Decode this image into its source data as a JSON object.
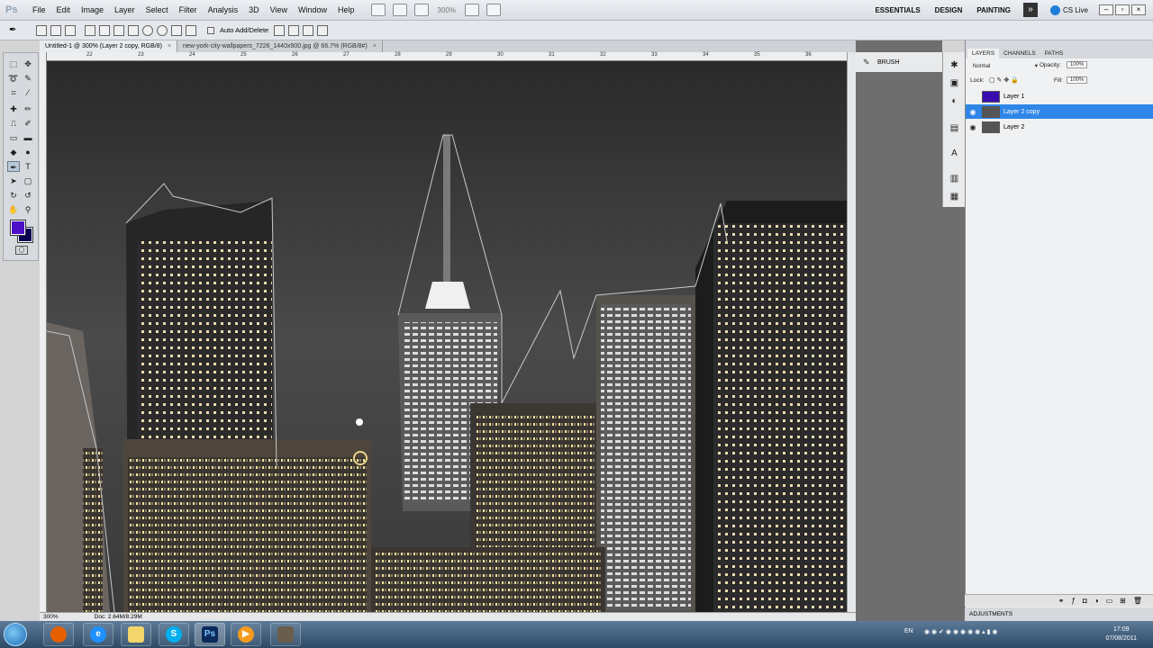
{
  "menu": {
    "logo": "Ps",
    "items": [
      "File",
      "Edit",
      "Image",
      "Layer",
      "Select",
      "Filter",
      "Analysis",
      "3D",
      "View",
      "Window",
      "Help"
    ],
    "zoom": "300%",
    "workspaces": [
      "ESSENTIALS",
      "DESIGN",
      "PAINTING"
    ],
    "cs_live": "CS Live"
  },
  "options_bar": {
    "auto_add_delete": "Auto Add/Delete"
  },
  "documents": {
    "tabs": [
      {
        "label": "Untitled-1 @ 300% (Layer 2 copy, RGB/8)",
        "active": true
      },
      {
        "label": "new-york-city-wallpapers_7226_1440x900.jpg @ 66.7% (RGB/8#)",
        "active": false
      }
    ]
  },
  "ruler": {
    "top_ticks": [
      "22",
      "23",
      "24",
      "25",
      "26",
      "27",
      "28",
      "29",
      "30",
      "31",
      "32",
      "33",
      "34",
      "35",
      "36"
    ]
  },
  "status": {
    "zoom": "300%",
    "doc": "Doc: 2.64M/8.29M"
  },
  "panels": {
    "brush_label": "BRUSH",
    "layers_tabs": [
      "LAYERS",
      "CHANNELS",
      "PATHS"
    ],
    "blend_mode": "Normal",
    "opacity_label": "Opacity:",
    "opacity_value": "100%",
    "lock_label": "Lock:",
    "fill_label": "Fill:",
    "fill_value": "100%",
    "layers": [
      {
        "name": "Layer 1",
        "visible": false,
        "selected": false,
        "thumb_color": "#3a0db0"
      },
      {
        "name": "Layer 2 copy",
        "visible": true,
        "selected": true,
        "thumb_color": "#555"
      },
      {
        "name": "Layer 2",
        "visible": true,
        "selected": false,
        "thumb_color": "#555"
      }
    ],
    "adjustments_label": "ADJUSTMENTS"
  },
  "colors": {
    "foreground": "#4b10c8",
    "background": "#0a0050",
    "selection": "#2f86e8"
  },
  "taskbar": {
    "apps": [
      "firefox",
      "ie",
      "explorer",
      "skype",
      "photoshop",
      "media-player",
      "gimp"
    ],
    "language": "EN",
    "time": "17:09",
    "date": "07/08/2011"
  }
}
